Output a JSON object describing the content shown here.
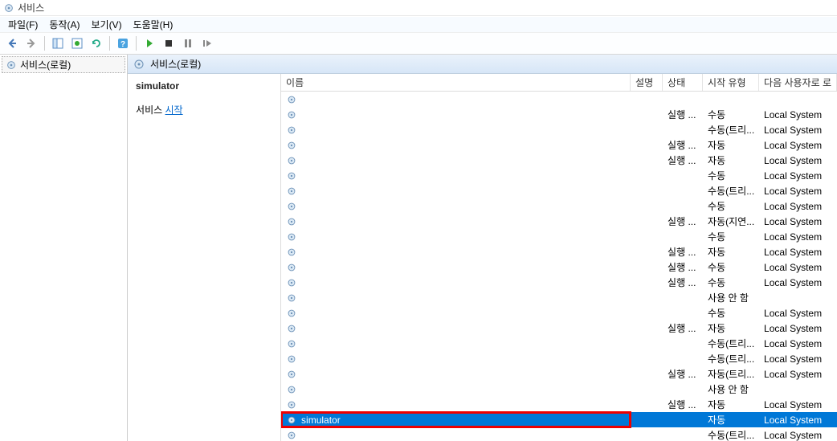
{
  "window_title": "서비스",
  "menu": {
    "file": "파일(F)",
    "action": "동작(A)",
    "view": "보기(V)",
    "help": "도움말(H)"
  },
  "tree": {
    "root": "서비스(로컬)"
  },
  "main_header": "서비스(로컬)",
  "detail": {
    "title": "simulator",
    "action_prefix": "서비스 ",
    "start_link": "시작"
  },
  "columns": {
    "name": "이름",
    "description": "설명",
    "status": "상태",
    "startup": "시작 유형",
    "logon": "다음 사용자로 로"
  },
  "rows": [
    {
      "name": "",
      "desc": "",
      "status": "",
      "startup": "",
      "logon": ""
    },
    {
      "name": "",
      "desc": "",
      "status": "실행 ...",
      "startup": "수동",
      "logon": "Local System"
    },
    {
      "name": "",
      "desc": "",
      "status": "",
      "startup": "수동(트리...",
      "logon": "Local System"
    },
    {
      "name": "",
      "desc": "",
      "status": "실행 ...",
      "startup": "자동",
      "logon": "Local System"
    },
    {
      "name": "",
      "desc": "",
      "status": "실행 ...",
      "startup": "자동",
      "logon": "Local System"
    },
    {
      "name": "",
      "desc": "",
      "status": "",
      "startup": "수동",
      "logon": "Local System"
    },
    {
      "name": "",
      "desc": "",
      "status": "",
      "startup": "수동(트리...",
      "logon": "Local System"
    },
    {
      "name": "",
      "desc": "",
      "status": "",
      "startup": "수동",
      "logon": "Local System"
    },
    {
      "name": "",
      "desc": "",
      "status": "실행 ...",
      "startup": "자동(지연...",
      "logon": "Local System"
    },
    {
      "name": "",
      "desc": "",
      "status": "",
      "startup": "수동",
      "logon": "Local System"
    },
    {
      "name": "",
      "desc": "",
      "status": "실행 ...",
      "startup": "자동",
      "logon": "Local System"
    },
    {
      "name": "",
      "desc": "",
      "status": "실행 ...",
      "startup": "수동",
      "logon": "Local System"
    },
    {
      "name": "",
      "desc": "",
      "status": "실행 ...",
      "startup": "수동",
      "logon": "Local System"
    },
    {
      "name": "",
      "desc": "",
      "status": "",
      "startup": "사용 안 함",
      "logon": ""
    },
    {
      "name": "",
      "desc": "",
      "status": "",
      "startup": "수동",
      "logon": "Local System"
    },
    {
      "name": "",
      "desc": "",
      "status": "실행 ...",
      "startup": "자동",
      "logon": "Local System"
    },
    {
      "name": "",
      "desc": "",
      "status": "",
      "startup": "수동(트리...",
      "logon": "Local System"
    },
    {
      "name": "",
      "desc": "",
      "status": "",
      "startup": "수동(트리...",
      "logon": "Local System"
    },
    {
      "name": "",
      "desc": "",
      "status": "실행 ...",
      "startup": "자동(트리...",
      "logon": "Local System"
    },
    {
      "name": "",
      "desc": "",
      "status": "",
      "startup": "사용 안 함",
      "logon": ""
    },
    {
      "name": "",
      "desc": "",
      "status": "실행 ...",
      "startup": "자동",
      "logon": "Local System"
    },
    {
      "name": "simulator",
      "desc": "",
      "status": "",
      "startup": "자동",
      "logon": "Local System",
      "selected": true
    },
    {
      "name": "",
      "desc": "",
      "status": "",
      "startup": "수동(트리...",
      "logon": "Local System"
    }
  ]
}
